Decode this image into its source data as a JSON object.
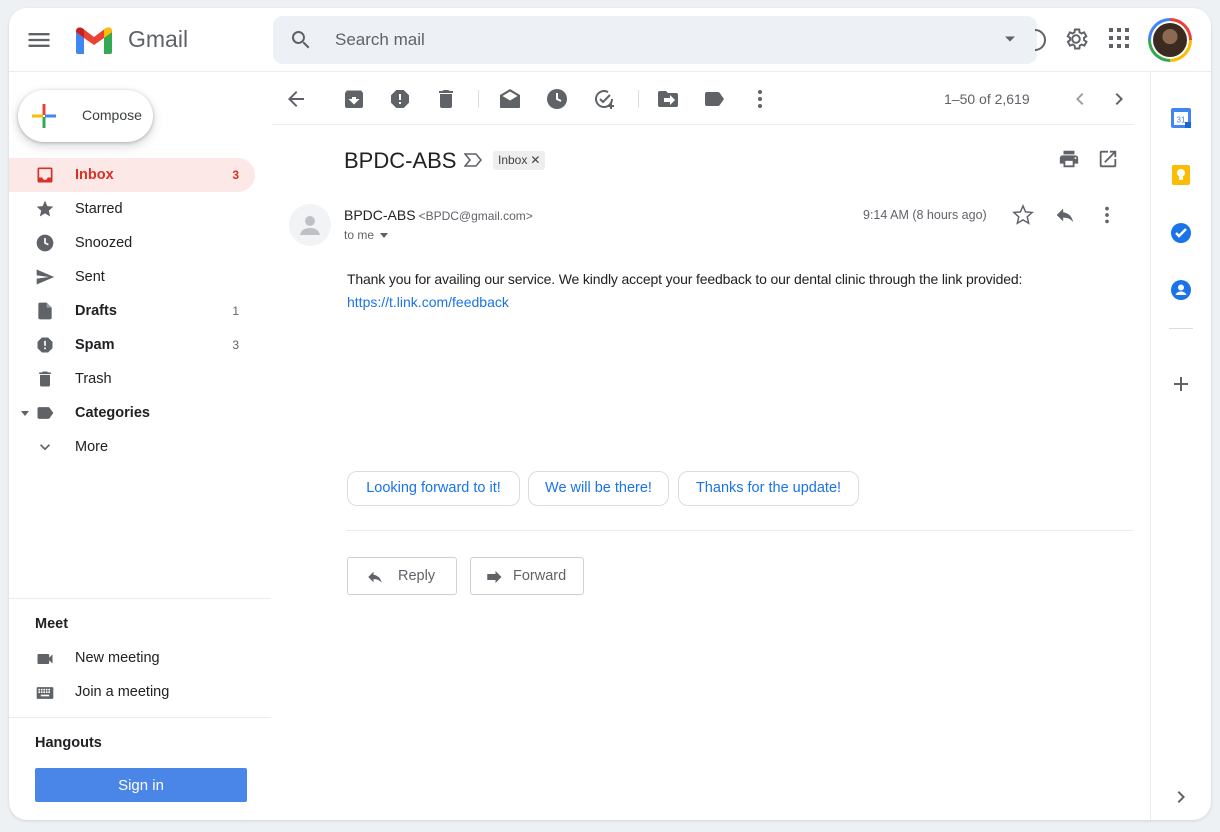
{
  "header": {
    "app_name": "Gmail",
    "search_placeholder": "Search mail"
  },
  "sidebar": {
    "compose_label": "Compose",
    "items": [
      {
        "label": "Inbox",
        "count": "3",
        "icon": "inbox-icon",
        "active": true
      },
      {
        "label": "Starred",
        "count": "",
        "icon": "star-icon"
      },
      {
        "label": "Snoozed",
        "count": "",
        "icon": "clock-icon"
      },
      {
        "label": "Sent",
        "count": "",
        "icon": "send-icon"
      },
      {
        "label": "Drafts",
        "count": "1",
        "icon": "draft-icon"
      },
      {
        "label": "Spam",
        "count": "3",
        "icon": "spam-icon"
      },
      {
        "label": "Trash",
        "count": "",
        "icon": "trash-icon"
      },
      {
        "label": "Categories",
        "count": "",
        "icon": "label-icon"
      },
      {
        "label": "More",
        "count": "",
        "icon": "chevron-down-icon"
      }
    ],
    "meet": {
      "title": "Meet",
      "new_meeting": "New meeting",
      "join_meeting": "Join a meeting"
    },
    "hangouts": {
      "title": "Hangouts",
      "sign_in": "Sign in"
    }
  },
  "toolbar": {
    "pagination": "1–50 of 2,619"
  },
  "message": {
    "subject": "BPDC-ABS",
    "label_chip": "Inbox",
    "sender_name": "BPDC-ABS",
    "sender_email": "<BPDC@gmail.com>",
    "recipient": "to me",
    "time": "9:14 AM (8 hours ago)",
    "body": "Thank you for availing our service. We kindly accept your feedback to our dental clinic through the link provided:",
    "link": "https://t.link.com/feedback",
    "smart_replies": [
      "Looking forward to it!",
      "We will be there!",
      "Thanks for the update!"
    ],
    "reply_label": "Reply",
    "forward_label": "Forward"
  },
  "rail": {
    "calendar_day": "31"
  },
  "colors": {
    "accent_red": "#d93025",
    "active_bg": "#fce8e6",
    "link_blue": "#1a73e8",
    "signin_blue": "#4a86e8"
  }
}
